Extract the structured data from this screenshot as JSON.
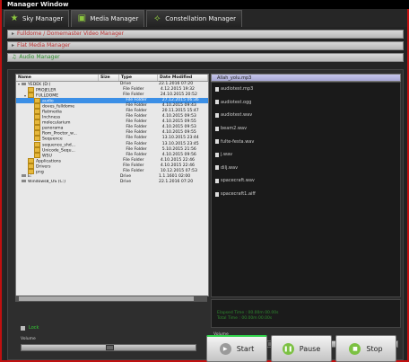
{
  "window": {
    "title": "Manager Window"
  },
  "tabs": [
    {
      "label": "Sky Manager",
      "icon": "star-icon"
    },
    {
      "label": "Media Manager",
      "icon": "film-icon"
    },
    {
      "label": "Constellation Manager",
      "icon": "constellation-icon"
    }
  ],
  "accordions": {
    "fulldome": "Fulldome / Domemaster Video Manager",
    "flat": "Flat Media Manager",
    "audio": "Audio Manager"
  },
  "browser": {
    "columns": [
      "Name",
      "Size",
      "Type",
      "Date Modified"
    ],
    "rows": [
      {
        "name": "YEDEK (D:)",
        "size": "",
        "type": "Drive",
        "date": "22.1.2016 07:20",
        "icon": "drive",
        "indent": 0,
        "exp": "▾"
      },
      {
        "name": "PROJELER",
        "size": "",
        "type": "File Folder",
        "date": "4.12.2015 19:32",
        "icon": "folder",
        "indent": 1,
        "exp": ""
      },
      {
        "name": "FULLDOME",
        "size": "",
        "type": "File Folder",
        "date": "24.10.2015 20:52",
        "icon": "folder",
        "indent": 1,
        "exp": "▾"
      },
      {
        "name": "audio",
        "size": "",
        "type": "File Folder",
        "date": "27.12.2015 06:36",
        "icon": "folder",
        "indent": 2,
        "exp": "",
        "selected": true
      },
      {
        "name": "doves_fulldome",
        "size": "",
        "type": "File Folder",
        "date": "4.10.2015 09:43",
        "icon": "folder",
        "indent": 2,
        "exp": ""
      },
      {
        "name": "flatmedia",
        "size": "",
        "type": "File Folder",
        "date": "20.11.2015 15:47",
        "icon": "folder",
        "indent": 2,
        "exp": ""
      },
      {
        "name": "Inchness",
        "size": "",
        "type": "File Folder",
        "date": "4.10.2015 09:53",
        "icon": "folder",
        "indent": 2,
        "exp": ""
      },
      {
        "name": "molecularium",
        "size": "",
        "type": "File Folder",
        "date": "4.10.2015 09:55",
        "icon": "folder",
        "indent": 2,
        "exp": ""
      },
      {
        "name": "panorama",
        "size": "",
        "type": "File Folder",
        "date": "4.10.2015 09:53",
        "icon": "folder",
        "indent": 2,
        "exp": ""
      },
      {
        "name": "Rom_Proctor_w...",
        "size": "",
        "type": "File Folder",
        "date": "4.10.2015 09:55",
        "icon": "folder",
        "indent": 2,
        "exp": ""
      },
      {
        "name": "Sequence",
        "size": "",
        "type": "File Folder",
        "date": "13.10.2015 23:44",
        "icon": "folder",
        "indent": 2,
        "exp": ""
      },
      {
        "name": "sequence_shd...",
        "size": "",
        "type": "File Folder",
        "date": "13.10.2015 23:45",
        "icon": "folder",
        "indent": 2,
        "exp": ""
      },
      {
        "name": "Unicode_Sequ...",
        "size": "",
        "type": "File Folder",
        "date": "5.10.2015 21:56",
        "icon": "folder",
        "indent": 2,
        "exp": ""
      },
      {
        "name": "WSU",
        "size": "",
        "type": "File Folder",
        "date": "4.10.2015 09:56",
        "icon": "folder",
        "indent": 2,
        "exp": ""
      },
      {
        "name": "Applications",
        "size": "",
        "type": "File Folder",
        "date": "4.10.2015 22:46",
        "icon": "folder",
        "indent": 1,
        "exp": ""
      },
      {
        "name": "Drivers",
        "size": "",
        "type": "File Folder",
        "date": "4.10.2015 22:46",
        "icon": "folder",
        "indent": 1,
        "exp": ""
      },
      {
        "name": "png",
        "size": "",
        "type": "File Folder",
        "date": "10.12.2015 07:53",
        "icon": "folder",
        "indent": 1,
        "exp": ""
      },
      {
        "name": "E:",
        "size": "",
        "type": "Drive",
        "date": "1.1.1601 02:00",
        "icon": "drive",
        "indent": 0,
        "exp": ""
      },
      {
        "name": "Windows8_OS (C:)",
        "size": "",
        "type": "Drive",
        "date": "22.1.2016 07:20",
        "icon": "drive",
        "indent": 0,
        "exp": ""
      }
    ]
  },
  "audio_files": [
    "Allah_yolu.mp3",
    "audiotest.mp3",
    "audiotest.ogg",
    "audiotest.wav",
    "beam2.wav",
    "fulte-festa.wav",
    "j.wav",
    "dilj.wav",
    "spacecraft.wav",
    "spacecraft1.aiff"
  ],
  "playback": {
    "elapsed": "Elapsed Time : 00.00m 00.00s",
    "total": "Total Time : 00.00m 00.00s"
  },
  "left_controls": {
    "lock": "Lock",
    "volume": "Volume"
  },
  "right_controls": {
    "volume": "Volume"
  },
  "buttons": {
    "start": "Start",
    "pause": "Pause",
    "stop": "Stop"
  },
  "colors": {
    "accent_green": "#2fd14a",
    "border_red": "#c01010",
    "selection_blue": "#3b8fe6"
  },
  "left_volume_level": 0.5,
  "right_volume_level": 0.3
}
